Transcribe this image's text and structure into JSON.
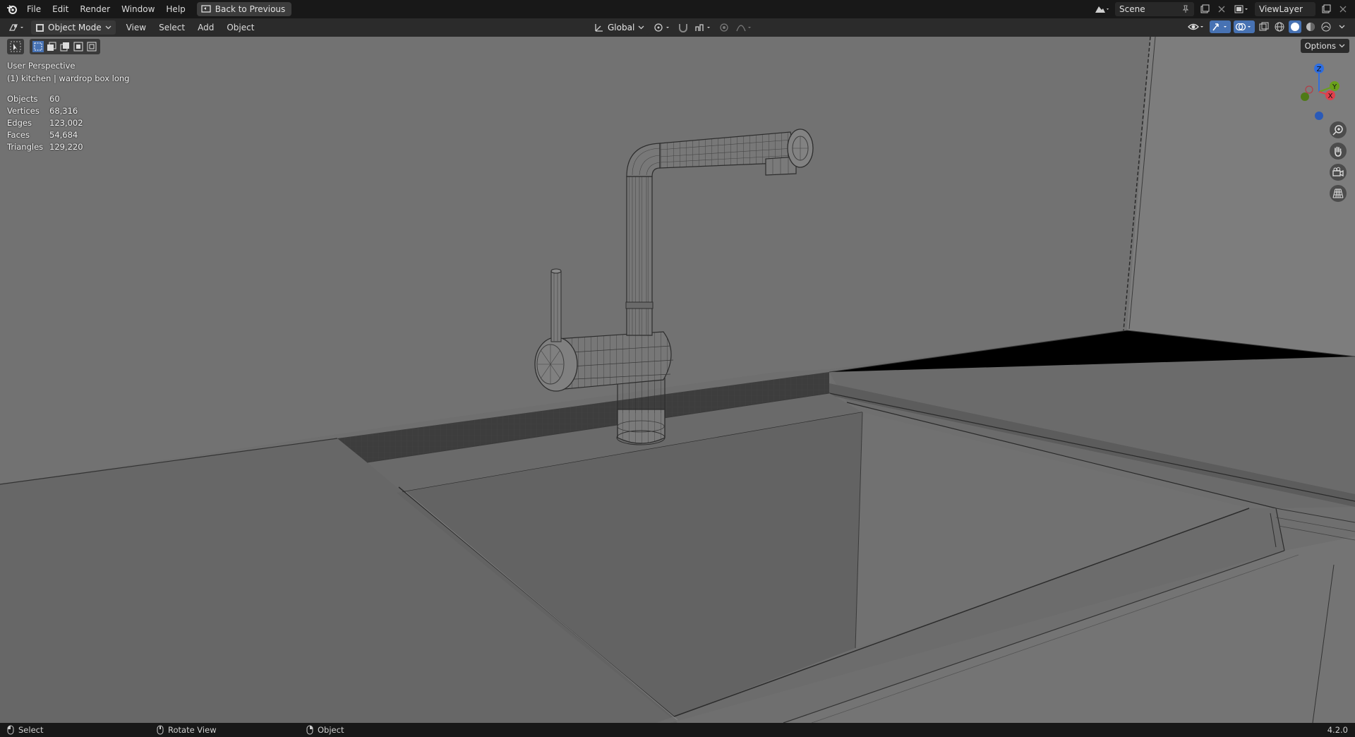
{
  "topbar": {
    "menus": [
      "File",
      "Edit",
      "Render",
      "Window",
      "Help"
    ],
    "back_button": "Back to Previous",
    "scene_name": "Scene",
    "view_layer": "ViewLayer"
  },
  "header": {
    "mode": "Object Mode",
    "menus": [
      "View",
      "Select",
      "Add",
      "Object"
    ],
    "transform_orientation": "Global"
  },
  "viewport": {
    "perspective": "User Perspective",
    "active_object": "(1) kitchen | wardrop box long",
    "options_label": "Options",
    "stats": [
      {
        "label": "Objects",
        "value": "60"
      },
      {
        "label": "Vertices",
        "value": "68,316"
      },
      {
        "label": "Edges",
        "value": "123,002"
      },
      {
        "label": "Faces",
        "value": "54,684"
      },
      {
        "label": "Triangles",
        "value": "129,220"
      }
    ],
    "gizmo_axes": {
      "z": "Z",
      "y": "Y",
      "x": "X"
    }
  },
  "statusbar": {
    "select": "Select",
    "rotate": "Rotate View",
    "object": "Object",
    "version": "4.2.0"
  },
  "colors": {
    "axis_x": "#e0404c",
    "axis_y": "#6aa01c",
    "axis_z": "#2f6ee0",
    "accent": "#4772b3"
  }
}
